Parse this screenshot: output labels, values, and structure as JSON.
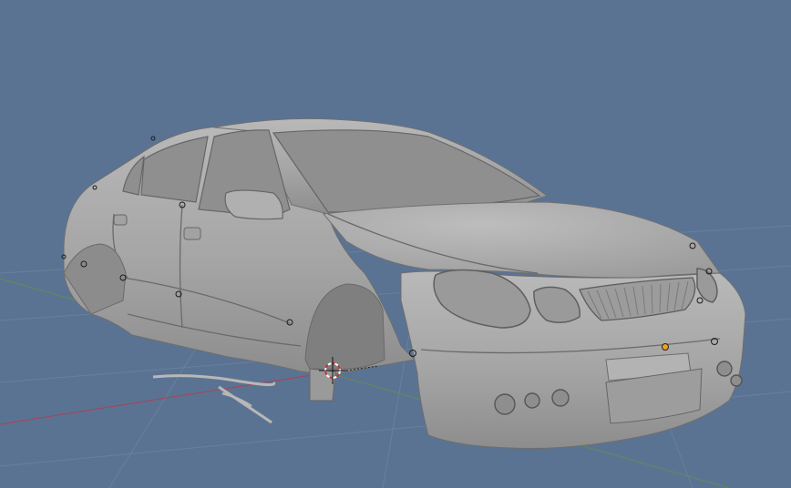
{
  "viewport": {
    "background": "#5b7393",
    "grid_color": "#6880a0",
    "x_axis_color": "#9e4a5a",
    "y_axis_color": "#5f8a5a",
    "model_color": "#a9a9a9",
    "origin_color": "#f0a020",
    "cursor_colors": [
      "#d03030",
      "#ffffff"
    ],
    "object": "car-body-mesh",
    "icons": [
      "3d-cursor-icon",
      "object-origin-icon"
    ]
  }
}
